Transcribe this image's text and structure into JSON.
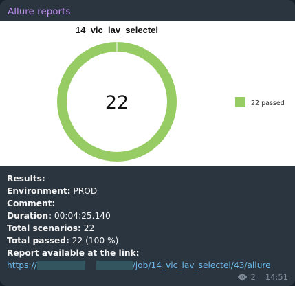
{
  "message": {
    "sender": "Allure reports",
    "time": "14:51",
    "views": "2"
  },
  "report_image": {
    "title": "14_vic_lav_selectel",
    "center_value": "22",
    "legend_label": "22 passed",
    "passed_color": "#97cc64"
  },
  "chart_data": {
    "type": "pie",
    "title": "14_vic_lav_selectel",
    "categories": [
      "passed"
    ],
    "values": [
      22
    ],
    "legend": [
      "22 passed"
    ],
    "colors": [
      "#97cc64"
    ],
    "legend_position": "right"
  },
  "body": {
    "results_label": "Results:",
    "environment_label": "Environment:",
    "environment_value": " PROD",
    "comment_label": "Comment:",
    "duration_label": "Duration:",
    "duration_value": " 00:04:25.140",
    "scenarios_label": "Total scenarios:",
    "scenarios_value": " 22",
    "passed_label": "Total passed:",
    "passed_value": " 22 (100 %)",
    "report_label": "Report available at the link:",
    "link_prefix": "https://",
    "link_suffix": "/job/14_vic_lav_selectel/43/allure"
  },
  "icons": {
    "views": "eye-icon"
  }
}
